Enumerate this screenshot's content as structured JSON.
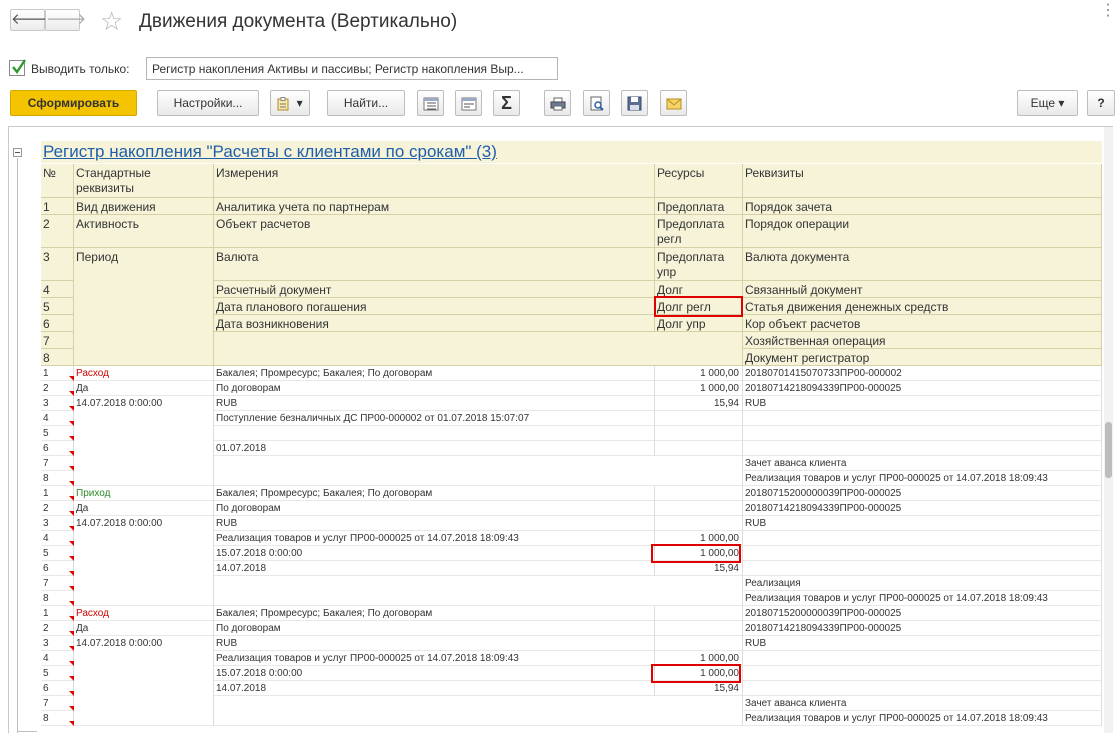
{
  "window": {
    "title": "Движения документа (Вертикально)",
    "back_symbol": "🡐",
    "forward_symbol": "🡒",
    "star_symbol": "☆",
    "more_symbol": "⋮"
  },
  "filter": {
    "checked": true,
    "label": "Выводить только:",
    "value": "Регистр накопления Активы и пассивы; Регистр накопления Выр..."
  },
  "toolbar": {
    "generate_label": "Сформировать",
    "settings_label": "Настройки...",
    "find_label": "Найти...",
    "sum_symbol": "Σ",
    "more_label": "Еще ▾",
    "help_label": "?",
    "dropdown_symbol": "▾",
    "accent_color": "#f4c400"
  },
  "report": {
    "title": "Регистр накопления \"Расчеты с клиентами по срокам\" (3)",
    "header": {
      "col_num": "№",
      "col_std": "Стандартные реквизиты",
      "col_dims": "Измерения",
      "col_res": "Ресурсы",
      "col_attrs": "Реквизиты",
      "nums": [
        "1",
        "2",
        "3",
        "4",
        "5",
        "6",
        "7",
        "8"
      ],
      "std": [
        "Вид движения",
        "Активность",
        "Период"
      ],
      "dims": [
        "Аналитика учета по партнерам",
        "Объект расчетов",
        "Валюта",
        "Расчетный документ",
        "Дата планового погашения",
        "Дата возникновения"
      ],
      "res": [
        "Предоплата",
        "Предоплата регл",
        "Предоплата упр",
        "Долг",
        "Долг регл",
        "Долг упр"
      ],
      "attrs": [
        "Порядок зачета",
        "Порядок операции",
        "Валюта документа",
        "Связанный документ",
        "Статья движения денежных средств",
        "Кор объект расчетов",
        "Хозяйственная операция",
        "Документ регистратор"
      ]
    },
    "records": [
      {
        "kind": "Расход",
        "kind_color": "#d00000",
        "activity": "Да",
        "period": "14.07.2018 0:00:00",
        "dims": [
          "Бакалея; Промресурс; Бакалея; По договорам",
          "По договорам",
          "RUB",
          "Поступление безналичных ДС ПР00-000002 от 01.07.2018 15:07:07",
          "",
          "01.07.2018"
        ],
        "res": [
          "1 000,00",
          "1 000,00",
          "15,94",
          "",
          "",
          ""
        ],
        "attrs": [
          "2018070141507073ЗПР00-000002",
          "20180714218094339ПР00-000025",
          "RUB",
          "",
          "",
          "",
          "Зачет аванса клиента",
          "Реализация товаров и услуг ПР00-000025 от 14.07.2018 18:09:43"
        ]
      },
      {
        "kind": "Приход",
        "kind_color": "#2a8a2a",
        "activity": "Да",
        "period": "14.07.2018 0:00:00",
        "dims": [
          "Бакалея; Промресурс; Бакалея; По договорам",
          "По договорам",
          "RUB",
          "Реализация товаров и услуг ПР00-000025 от 14.07.2018 18:09:43",
          "15.07.2018 0:00:00",
          "14.07.2018"
        ],
        "res": [
          "",
          "",
          "",
          "1 000,00",
          "1 000,00",
          "15,94"
        ],
        "attrs": [
          "20180715200000039ПР00-000025",
          "20180714218094339ПР00-000025",
          "RUB",
          "",
          "",
          "",
          "Реализация",
          "Реализация товаров и услуг ПР00-000025 от 14.07.2018 18:09:43"
        ]
      },
      {
        "kind": "Расход",
        "kind_color": "#d00000",
        "activity": "Да",
        "period": "14.07.2018 0:00:00",
        "dims": [
          "Бакалея; Промресурс; Бакалея; По договорам",
          "По договорам",
          "RUB",
          "Реализация товаров и услуг ПР00-000025 от 14.07.2018 18:09:43",
          "15.07.2018 0:00:00",
          "14.07.2018"
        ],
        "res": [
          "",
          "",
          "",
          "1 000,00",
          "1 000,00",
          "15,94"
        ],
        "attrs": [
          "20180715200000039ПР00-000025",
          "20180714218094339ПР00-000025",
          "RUB",
          "",
          "",
          "",
          "Зачет аванса клиента",
          "Реализация товаров и услуг ПР00-000025 от 14.07.2018 18:09:43"
        ]
      }
    ]
  }
}
